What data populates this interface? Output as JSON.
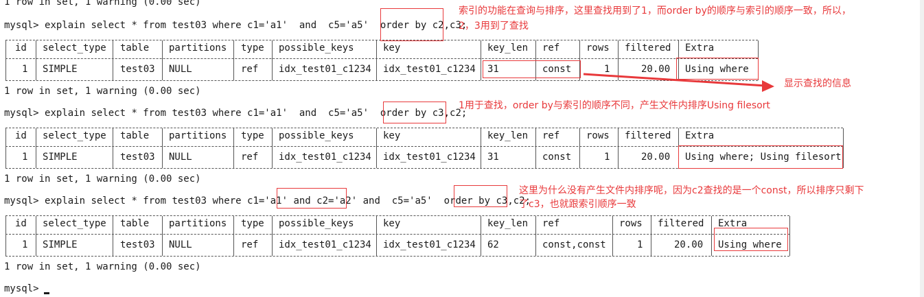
{
  "terminal": {
    "prompt": "mysql> ",
    "status_line": "1 row in set, 1 warning (0.00 sec)",
    "queries": [
      "explain select * from test03 where c1='a1'  and  c5='a5'  order by c2,c3;",
      "explain select * from test03 where c1='a1'  and  c5='a5'  order by c3,c2;",
      "explain select * from test03 where c1='a1' and c2='a2' and  c5='a5'  order by c3,c2;"
    ],
    "columns": [
      "id",
      "select_type",
      "table",
      "partitions",
      "type",
      "possible_keys",
      "key",
      "key_len",
      "ref",
      "rows",
      "filtered",
      "Extra"
    ],
    "results": [
      [
        "1",
        "SIMPLE",
        "test03",
        "NULL",
        "ref",
        "idx_test01_c1234",
        "idx_test01_c1234",
        "31",
        "const",
        "1",
        "20.00",
        "Using where"
      ],
      [
        "1",
        "SIMPLE",
        "test03",
        "NULL",
        "ref",
        "idx_test01_c1234",
        "idx_test01_c1234",
        "31",
        "const",
        "1",
        "20.00",
        "Using where; Using filesort"
      ],
      [
        "1",
        "SIMPLE",
        "test03",
        "NULL",
        "ref",
        "idx_test01_c1234",
        "idx_test01_c1234",
        "62",
        "const,const",
        "1",
        "20.00",
        "Using where"
      ]
    ]
  },
  "annotations": {
    "note1_line1": "索引的功能在查询与排序，这里查找用到了1，而order by的顺序与索引的顺序一致，所以，",
    "note1_line2": "2，3用到了查找",
    "note_arrow": "显示查找的信息",
    "note2": "1用于查找，order by与索引的顺序不同，产生文件内排序Using filesort",
    "note3_line1": "这里为什么没有产生文件内排序呢，因为c2查找的是一个const，所以排序只剩下",
    "note3_line2": "了c3，也就跟索引顺序一致"
  },
  "colors": {
    "annotation": "#e8393b",
    "text": "#1a1a1a",
    "background": "#ffffff"
  }
}
